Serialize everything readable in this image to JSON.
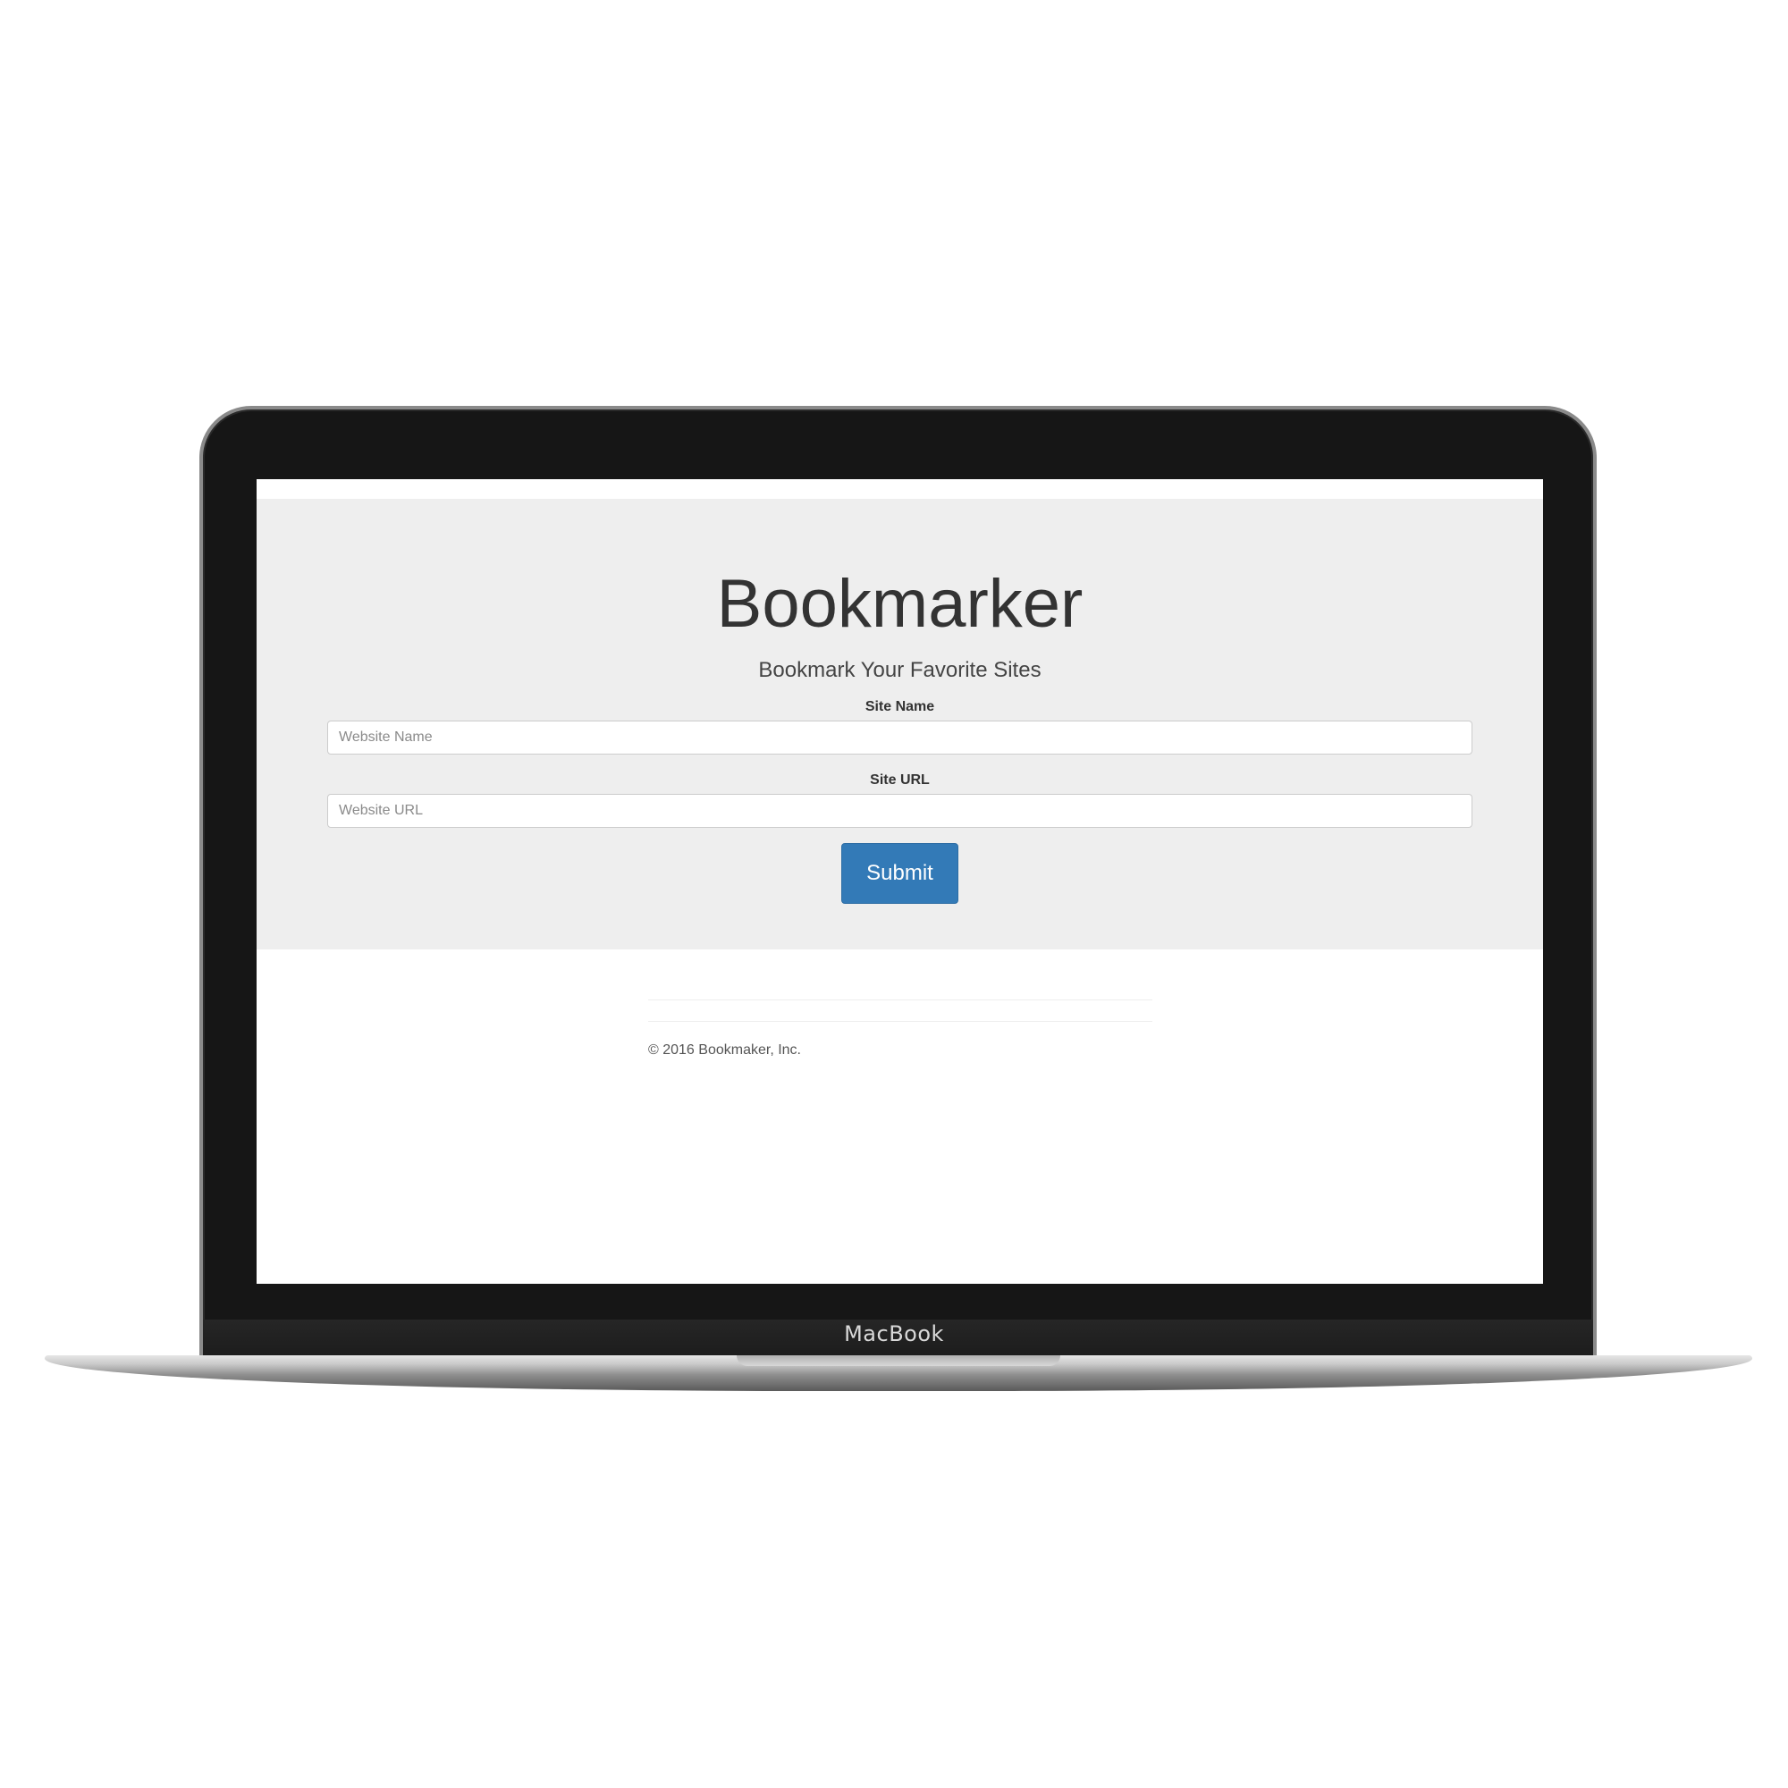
{
  "device": {
    "brand_label": "MacBook"
  },
  "header": {
    "title": "Bookmarker",
    "subtitle": "Bookmark Your Favorite Sites"
  },
  "form": {
    "site_name_label": "Site Name",
    "site_name_placeholder": "Website Name",
    "site_name_value": "",
    "site_url_label": "Site URL",
    "site_url_placeholder": "Website URL",
    "site_url_value": "",
    "submit_label": "Submit"
  },
  "footer": {
    "copyright": "© 2016 Bookmaker, Inc."
  },
  "colors": {
    "jumbotron_bg": "#eeeeee",
    "primary_button": "#337ab7",
    "text": "#333333"
  }
}
